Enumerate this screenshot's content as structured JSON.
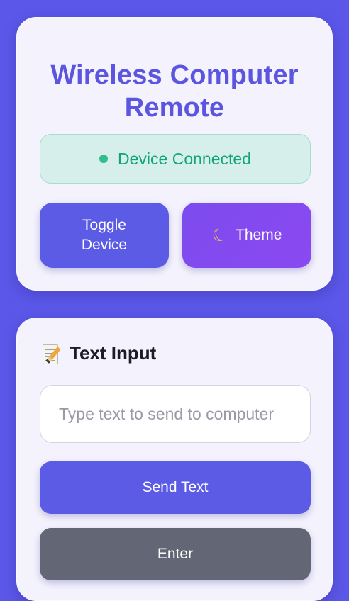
{
  "header": {
    "title": "Wireless Computer Remote"
  },
  "status": {
    "text": "Device Connected",
    "color": "#12a574"
  },
  "controls": {
    "toggle_label": "Toggle Device",
    "theme_icon": "crescent-moon-icon",
    "theme_label": "Theme"
  },
  "text_input_section": {
    "icon": "memo-pencil-icon",
    "title": "Text Input",
    "placeholder": "Type text to send to computer",
    "value": "",
    "send_label": "Send Text",
    "enter_label": "Enter"
  },
  "colors": {
    "background": "#5b57e8",
    "accent": "#5b5be6",
    "theme_button": "#8b49f1",
    "enter_button": "#636775"
  }
}
